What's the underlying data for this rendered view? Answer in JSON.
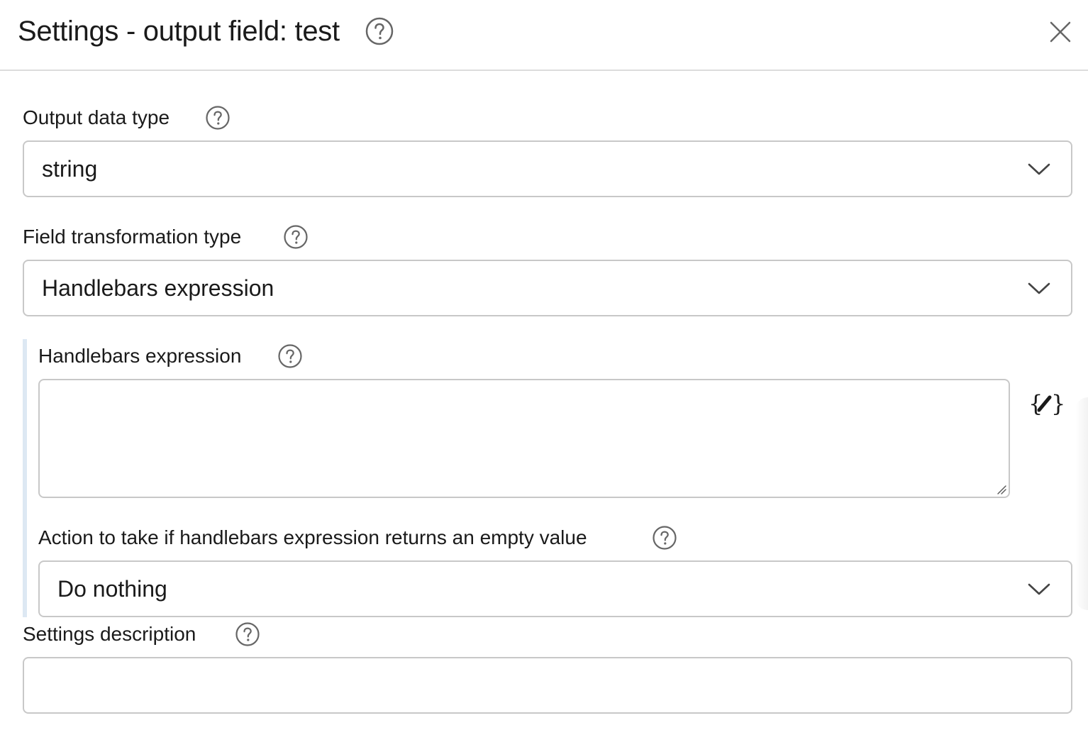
{
  "header": {
    "title": "Settings - output field: test"
  },
  "fields": {
    "output_data_type": {
      "label": "Output data type",
      "value": "string"
    },
    "field_transformation_type": {
      "label": "Field transformation type",
      "value": "Handlebars expression"
    },
    "handlebars_expression": {
      "label": "Handlebars expression",
      "value": ""
    },
    "empty_value_action": {
      "label": "Action to take if handlebars expression returns an empty value",
      "value": "Do nothing"
    },
    "settings_description": {
      "label": "Settings description",
      "value": ""
    }
  },
  "icons": {
    "help": "help-circle-icon",
    "close": "close-icon",
    "dropdown": "chevron-down-icon",
    "handlebars_editor": "handlebars-edit-icon",
    "resize": "resize-grip-icon"
  },
  "colors": {
    "border": "#c8c8c8",
    "divider": "#dcdcdc",
    "nested_bar": "#dde8f3",
    "text": "#1a1a1a",
    "icon": "#666666"
  }
}
